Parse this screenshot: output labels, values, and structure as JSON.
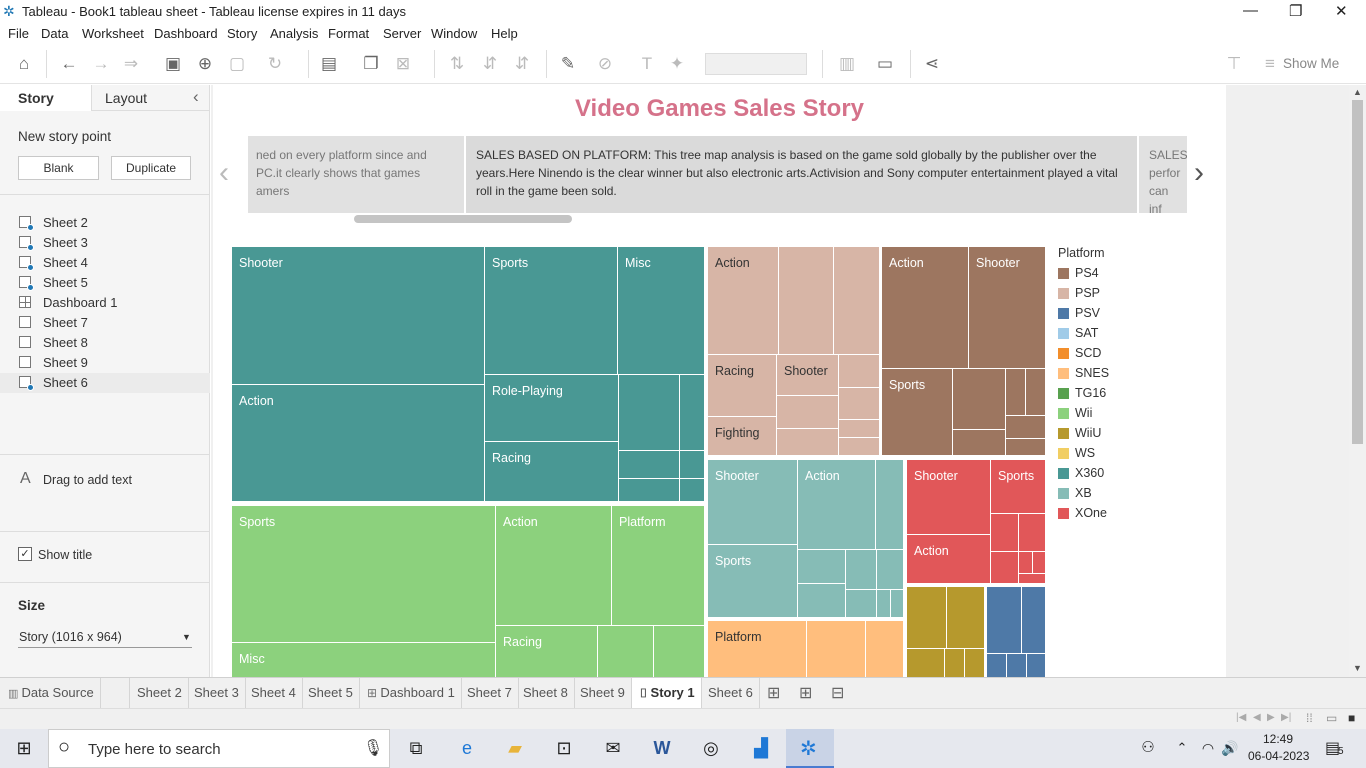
{
  "window": {
    "title": "Tableau - Book1 tableau sheet - Tableau license expires in 11 days",
    "controls": [
      "—",
      "❐",
      "✕"
    ]
  },
  "menu": [
    "File",
    "Data",
    "Worksheet",
    "Dashboard",
    "Story",
    "Analysis",
    "Format",
    "Server",
    "Window",
    "Help"
  ],
  "toolbar": {
    "show_me": "Show Me"
  },
  "left_pane": {
    "tab_story": "Story",
    "tab_layout": "Layout",
    "collapse": "‹",
    "new_story_point": "New story point",
    "blank_button": "Blank",
    "duplicate_button": "Duplicate",
    "sheets": [
      "Sheet 2",
      "Sheet 3",
      "Sheet 4",
      "Sheet 5",
      "Dashboard 1",
      "Sheet 7",
      "Sheet 8",
      "Sheet 9",
      "Sheet 6"
    ],
    "drag_icon": "A",
    "drag_text": "Drag to add text",
    "show_title": "Show title",
    "size_header": "Size",
    "size_value": "Story (1016 x 964)"
  },
  "story": {
    "title": "Video Games Sales Story",
    "caption_prev": "ned on every platform since and PC.it clearly shows that games amers",
    "caption_current": "SALES BASED ON PLATFORM: This tree map analysis is based on the game sold globally by the publisher over the years.Here Ninendo is the clear winner but also electronic arts.Activision and Sony computer entertainment played a vital roll in the game been sold.",
    "caption_next": "SALES perfor can inf"
  },
  "treemap_labels": {
    "x360_shooter": "Shooter",
    "x360_sports": "Sports",
    "x360_misc": "Misc",
    "x360_action": "Action",
    "x360_roleplaying": "Role-Playing",
    "x360_racing": "Racing",
    "wii_sports": "Sports",
    "wii_action": "Action",
    "wii_platform": "Platform",
    "wii_racing": "Racing",
    "wii_misc": "Misc",
    "psp_action": "Action",
    "psp_racing": "Racing",
    "psp_shooter": "Shooter",
    "psp_fighting": "Fighting",
    "ps4_action": "Action",
    "ps4_shooter": "Shooter",
    "ps4_sports": "Sports",
    "xb_shooter": "Shooter",
    "xb_action": "Action",
    "xb_sports": "Sports",
    "xone_shooter": "Shooter",
    "xone_sports": "Sports",
    "xone_action": "Action",
    "snes_platform": "Platform"
  },
  "legend": {
    "title": "Platform",
    "items": [
      {
        "name": "PS4",
        "color": "#9d7660"
      },
      {
        "name": "PSP",
        "color": "#d7b5a6"
      },
      {
        "name": "PSV",
        "color": "#4e79a7"
      },
      {
        "name": "SAT",
        "color": "#a0cbe8"
      },
      {
        "name": "SCD",
        "color": "#f28e2b"
      },
      {
        "name": "SNES",
        "color": "#ffbe7d"
      },
      {
        "name": "TG16",
        "color": "#59a14f"
      },
      {
        "name": "Wii",
        "color": "#8cd17d"
      },
      {
        "name": "WiiU",
        "color": "#b6992d"
      },
      {
        "name": "WS",
        "color": "#f1ce63"
      },
      {
        "name": "X360",
        "color": "#499894"
      },
      {
        "name": "XB",
        "color": "#86bcb6"
      },
      {
        "name": "XOne",
        "color": "#e15759"
      }
    ]
  },
  "bottom_tabs": {
    "data_source": "Data Source",
    "tabs": [
      "Sheet 2",
      "Sheet 3",
      "Sheet 4",
      "Sheet 5",
      "Dashboard 1",
      "Sheet 7",
      "Sheet 8",
      "Sheet 9",
      "Story 1",
      "Sheet 6"
    ],
    "active": "Story 1"
  },
  "taskbar": {
    "search_placeholder": "Type here to search",
    "time": "12:49",
    "date": "06-04-2023",
    "notifications": "5"
  }
}
